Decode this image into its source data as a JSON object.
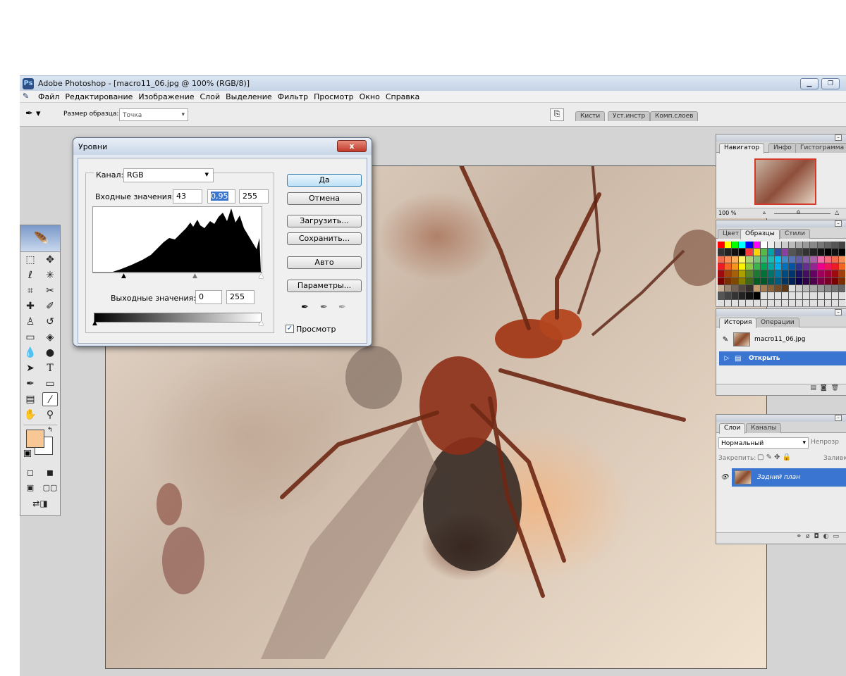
{
  "window": {
    "title": "Adobe Photoshop - [macro11_06.jpg @ 100% (RGB/8)]",
    "app_icon": "photoshop-icon",
    "buttons": [
      "minimize",
      "restore"
    ]
  },
  "menu": {
    "items": [
      "Файл",
      "Редактирование",
      "Изображение",
      "Слой",
      "Выделение",
      "Фильтр",
      "Просмотр",
      "Окно",
      "Справка"
    ]
  },
  "options": {
    "tool_icon": "eyedropper-icon",
    "sample_size_label": "Размер образца:",
    "sample_size_value": "Точка",
    "tabs": [
      "Кисти",
      "Уст.инстр",
      "Комп.слоев"
    ]
  },
  "levels_dialog": {
    "title": "Уровни",
    "close_label": "x",
    "channel_label": "Канал:",
    "channel_value": "RGB",
    "input_label": "Входные значения:",
    "input_black": "43",
    "input_gamma": "0,95",
    "input_white": "255",
    "output_label": "Выходные значения:",
    "output_black": "0",
    "output_white": "255",
    "buttons": {
      "ok": "Да",
      "cancel": "Отмена",
      "load": "Загрузить...",
      "save": "Сохранить...",
      "auto": "Авто",
      "options": "Параметры..."
    },
    "preview_label": "Просмотр",
    "preview_checked": true,
    "eyedropper_icons": [
      "black-point-eyedropper-icon",
      "gray-point-eyedropper-icon",
      "white-point-eyedropper-icon"
    ]
  },
  "navigator_panel": {
    "tabs": [
      "Навигатор",
      "Инфо",
      "Гистограмма"
    ],
    "zoom": "100 %"
  },
  "swatches_panel": {
    "tabs": [
      "Цвет",
      "Образцы",
      "Стили"
    ]
  },
  "history_panel": {
    "tabs": [
      "История",
      "Операции"
    ],
    "snapshot_name": "macro11_06.jpg",
    "step_name": "Открыть"
  },
  "layers_panel": {
    "tabs": [
      "Слои",
      "Каналы"
    ],
    "blend_mode": "Нормальный",
    "opacity_label": "Непрозр",
    "lock_label": "Закрепить:",
    "fill_label": "Заливк",
    "layer_name": "Задний план"
  },
  "colors": {
    "foreground": "#f7c896",
    "background": "#ffffff",
    "selection": "#3a76d1"
  }
}
